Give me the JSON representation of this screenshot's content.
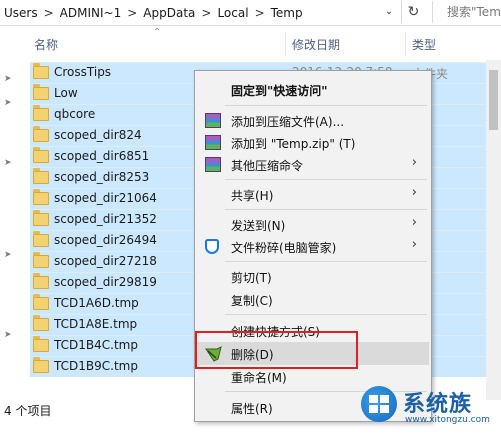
{
  "address_bar": {
    "crumbs": [
      "Users",
      "ADMINI~1",
      "AppData",
      "Local",
      "Temp"
    ],
    "separator": ">",
    "search_placeholder": "搜索\"Tem"
  },
  "columns": {
    "name": "名称",
    "date": "修改日期",
    "type": "类型"
  },
  "files": [
    {
      "name": "CrossTips",
      "date": "2016-12-20 7:58",
      "type": "文件夹",
      "icon": "folder-icon"
    },
    {
      "name": "Low",
      "date": "",
      "type": "",
      "icon": "folder-icon"
    },
    {
      "name": "qbcore",
      "date": "",
      "type": "",
      "icon": "folder-icon"
    },
    {
      "name": "scoped_dir824",
      "date": "",
      "type": "",
      "icon": "folder-icon"
    },
    {
      "name": "scoped_dir6851",
      "date": "",
      "type": "",
      "icon": "folder-icon"
    },
    {
      "name": "scoped_dir8253",
      "date": "",
      "type": "",
      "icon": "folder-icon"
    },
    {
      "name": "scoped_dir21064",
      "date": "",
      "type": "",
      "icon": "folder-icon"
    },
    {
      "name": "scoped_dir21352",
      "date": "",
      "type": "",
      "icon": "folder-icon"
    },
    {
      "name": "scoped_dir26494",
      "date": "",
      "type": "",
      "icon": "folder-icon"
    },
    {
      "name": "scoped_dir27218",
      "date": "",
      "type": "",
      "icon": "folder-icon"
    },
    {
      "name": "scoped_dir29819",
      "date": "",
      "type": "",
      "icon": "folder-icon"
    },
    {
      "name": "TCD1A6D.tmp",
      "date": "",
      "type": "",
      "icon": "folder-icon"
    },
    {
      "name": "TCD1A8E.tmp",
      "date": "",
      "type": "",
      "icon": "folder-icon"
    },
    {
      "name": "TCD1B4C.tmp",
      "date": "",
      "type": "",
      "icon": "folder-icon"
    },
    {
      "name": "TCD1B9C.tmp",
      "date": "",
      "type": "",
      "icon": "folder-icon"
    }
  ],
  "status_bar": {
    "item_count": "4 个项目"
  },
  "context_menu": {
    "pin_quick_access": "固定到\"快速访问\"",
    "add_to_archive": "添加到压缩文件(A)...",
    "add_to_temp_zip": "添加到 \"Temp.zip\" (T)",
    "other_compress": "其他压缩命令",
    "share": "共享(H)",
    "send_to": "发送到(N)",
    "file_shredder": "文件粉碎(电脑管家)",
    "cut": "剪切(T)",
    "copy": "复制(C)",
    "create_shortcut": "创建快捷方式(S)",
    "delete": "删除(D)",
    "rename": "重命名(M)",
    "properties": "属性(R)",
    "submenu_arrow": "›"
  },
  "watermark": {
    "title": "系统族",
    "url": "www.xitongzu.com"
  },
  "colors": {
    "selection": "#cce8ff",
    "menu_bg": "#f2f2f2",
    "highlight_border": "#e02020"
  }
}
